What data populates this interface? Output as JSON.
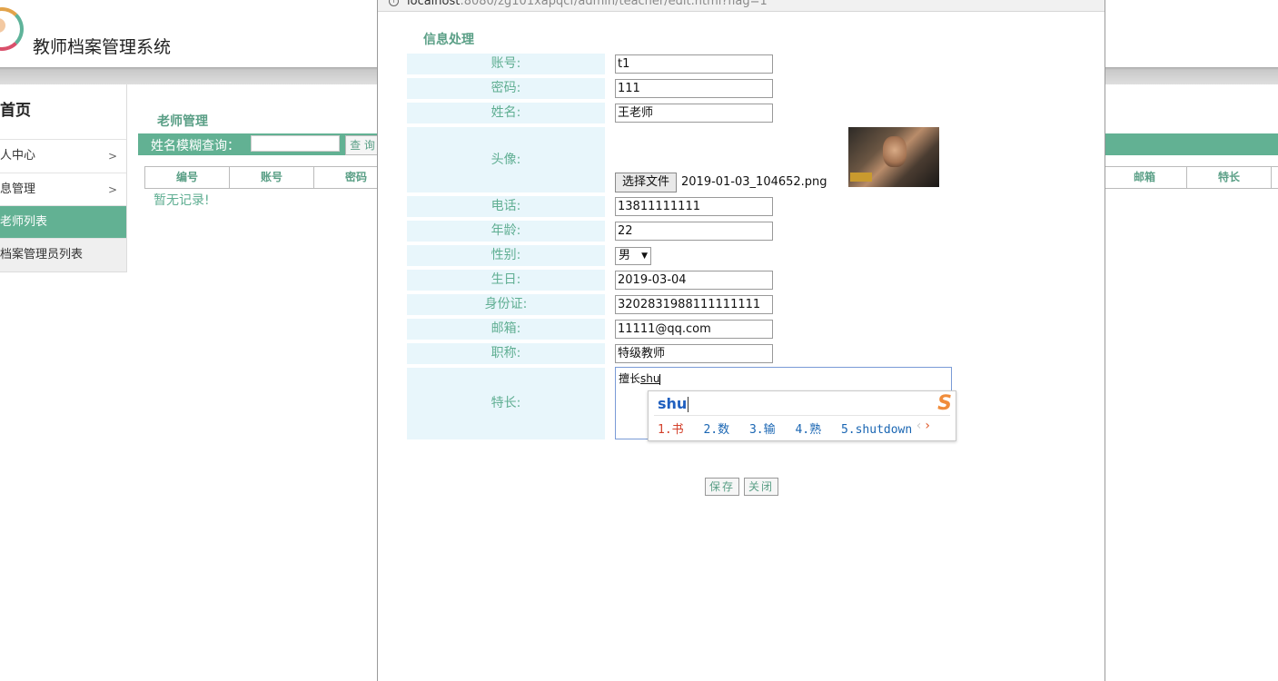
{
  "app": {
    "title": "教师档案管理系统"
  },
  "sidebar": {
    "home": "首页",
    "items": [
      {
        "label": "人中心",
        "arrow": ">"
      },
      {
        "label": "息管理",
        "arrow": ">"
      },
      {
        "label": "老师列表"
      },
      {
        "label": "档案管理员列表"
      }
    ]
  },
  "main": {
    "section_title": "老师管理",
    "search": {
      "label": "姓名模糊查询：",
      "value": "",
      "button": "查 询"
    },
    "table_headers_left": [
      "编号",
      "账号",
      "密码"
    ],
    "table_headers_right": [
      "邮箱",
      "特长"
    ],
    "empty_text": "暂无记录!"
  },
  "modal": {
    "url_host": "localhost",
    "url_rest": ":8080/zg101xapqcf/admin/teacher/edit.html?flag=1",
    "form_title": "信息处理",
    "labels": {
      "account": "账号:",
      "password": "密码:",
      "name": "姓名:",
      "avatar": "头像:",
      "phone": "电话:",
      "age": "年龄:",
      "gender": "性别:",
      "birthday": "生日:",
      "idcard": "身份证:",
      "email": "邮箱:",
      "title": "职称:",
      "specialty": "特长:"
    },
    "values": {
      "account": "t1",
      "password": "111",
      "name": "王老师",
      "phone": "13811111111",
      "age": "22",
      "gender": "男",
      "birthday": "2019-03-04",
      "idcard": "3202831988111111111",
      "email": "11111@qq.com",
      "title": "特级教师",
      "specialty_text": "擅长",
      "specialty_composing": "shu"
    },
    "file": {
      "button": "选择文件",
      "name": "2019-01-03_104652.png"
    },
    "ime": {
      "composition": "shu",
      "candidates": [
        "1.书",
        "2.数",
        "3.输",
        "4.熟",
        "5.shutdown"
      ],
      "prev": "‹",
      "next": "›"
    },
    "buttons": {
      "save": "保存",
      "close": "关闭"
    }
  }
}
